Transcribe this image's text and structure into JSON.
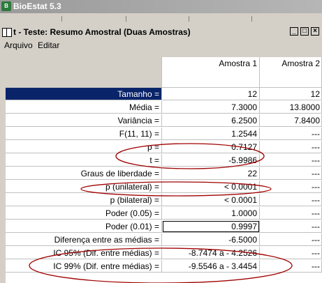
{
  "app": {
    "title": "BioEstat 5.3",
    "icon_name": "bioestat-app-icon"
  },
  "window": {
    "title": "t - Teste: Resumo Amostral (Duas Amostras)",
    "icon_name": "book-icon"
  },
  "menu": {
    "items": [
      "Arquivo",
      "Editar"
    ]
  },
  "table": {
    "columns": [
      "Amostra 1",
      "Amostra 2"
    ],
    "rows": [
      {
        "label": "Tamanho =",
        "a1": "12",
        "a2": "12"
      },
      {
        "label": "Média =",
        "a1": "7.3000",
        "a2": "13.8000"
      },
      {
        "label": "Variância =",
        "a1": "6.2500",
        "a2": "7.8400"
      },
      {
        "label": "F(11, 11) =",
        "a1": "1.2544",
        "a2": "---"
      },
      {
        "label": "p =",
        "a1": "0.7127",
        "a2": "---"
      },
      {
        "label": "t =",
        "a1": "-5.9986",
        "a2": "---"
      },
      {
        "label": "Graus de liberdade =",
        "a1": "22",
        "a2": "---"
      },
      {
        "label": "p (unilateral) =",
        "a1": "< 0.0001",
        "a2": "---"
      },
      {
        "label": "p (bilateral) =",
        "a1": "< 0.0001",
        "a2": "---"
      },
      {
        "label": "Poder (0.05) =",
        "a1": "1.0000",
        "a2": "---"
      },
      {
        "label": "Poder (0.01) =",
        "a1": "0.9997",
        "a2": "---"
      },
      {
        "label": "Diferença entre as médias =",
        "a1": "-6.5000",
        "a2": "---"
      },
      {
        "label": "IC 95% (Dif. entre médias) =",
        "a1": "-8.7474 a - 4.2526",
        "a2": "---"
      },
      {
        "label": "IC 99% (Dif. entre médias) =",
        "a1": "-9.5546 a - 3.4454",
        "a2": "---"
      }
    ]
  },
  "colors": {
    "annotation": "#a00000",
    "selection": "#0a246a"
  }
}
